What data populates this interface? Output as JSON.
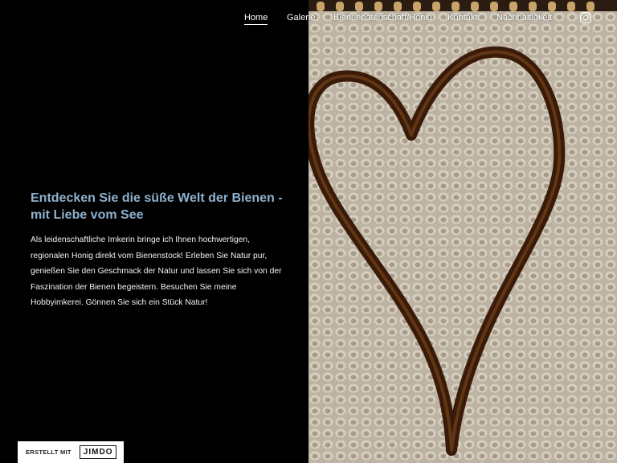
{
  "nav": {
    "items": [
      {
        "label": "Home",
        "active": true
      },
      {
        "label": "Galerie",
        "active": false
      },
      {
        "label": "Bienenpatenschaft/Honig",
        "active": false
      },
      {
        "label": "Kontakt",
        "active": false
      },
      {
        "label": "Nachhaltigkeit",
        "active": false
      }
    ],
    "social_icon": "instagram-icon"
  },
  "hero": {
    "title": "Entdecken Sie die süße Welt der Bienen - mit Liebe vom See",
    "body": "Als leidenschaftliche Imkerin bringe ich Ihnen hochwertigen, regionalen Honig direkt vom Bienenstock! Erleben Sie Natur pur, genießen Sie den Geschmack der Natur und lassen Sie sich von der Faszination der Bienen begeistern. Besuchen Sie meine Hobbyimkerei. Gönnen Sie sich ein Stück Natur!"
  },
  "badge": {
    "prefix": "ERSTELLT MIT",
    "logo": "JIMDO"
  },
  "colors": {
    "background": "#000000",
    "title_accent": "#8fb2cf",
    "honey_heart": "#3a1a08"
  }
}
